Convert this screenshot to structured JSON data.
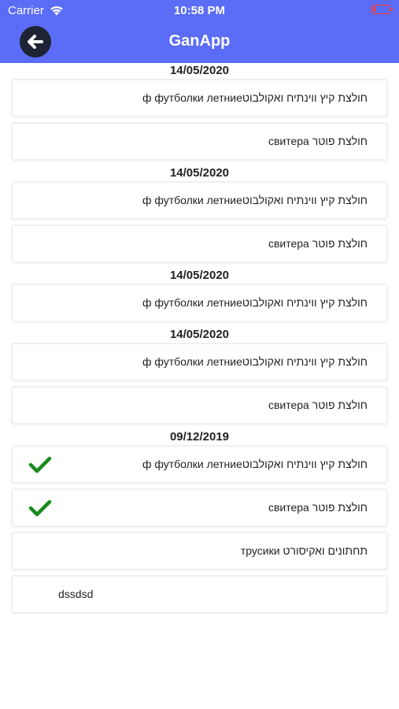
{
  "status_bar": {
    "carrier": "Carrier",
    "time": "10:58 PM",
    "icons": [
      "wifi-icon",
      "battery-icon"
    ]
  },
  "nav": {
    "title": "GanApp",
    "back_icon": "arrow-left-icon",
    "color": "#5b6cf6"
  },
  "groups": [
    {
      "date": "14/05/2020",
      "items": [
        {
          "text": "חולצת קיץ ווינתיח ואקולבוטф футболки летние",
          "checked": false
        },
        {
          "text": "חולצת פוטר свитера",
          "checked": false
        }
      ]
    },
    {
      "date": "14/05/2020",
      "items": [
        {
          "text": "חולצת קיץ ווינתיח ואקולבוטф футболки летние",
          "checked": false
        },
        {
          "text": "חולצת פוטר свитера",
          "checked": false
        }
      ]
    },
    {
      "date": "14/05/2020",
      "items": [
        {
          "text": "חולצת קיץ ווינתיח ואקולבוטф футболки летние",
          "checked": false
        }
      ]
    },
    {
      "date": "14/05/2020",
      "items": [
        {
          "text": "חולצת קיץ ווינתיח ואקולבוטф футболки летние",
          "checked": false
        },
        {
          "text": "חולצת פוטר свитера",
          "checked": false
        }
      ]
    },
    {
      "date": "09/12/2019",
      "items": [
        {
          "text": "חולצת קיץ ווינתיח ואקולבוטф футболки летние",
          "checked": true
        },
        {
          "text": "חולצת פוטר свитера",
          "checked": true
        },
        {
          "text": "תחתונים ואקיסורט трусики",
          "checked": false
        },
        {
          "text": "dssdsd",
          "checked": false,
          "ltr": true
        }
      ]
    }
  ],
  "check_color": "#1a8a1a"
}
